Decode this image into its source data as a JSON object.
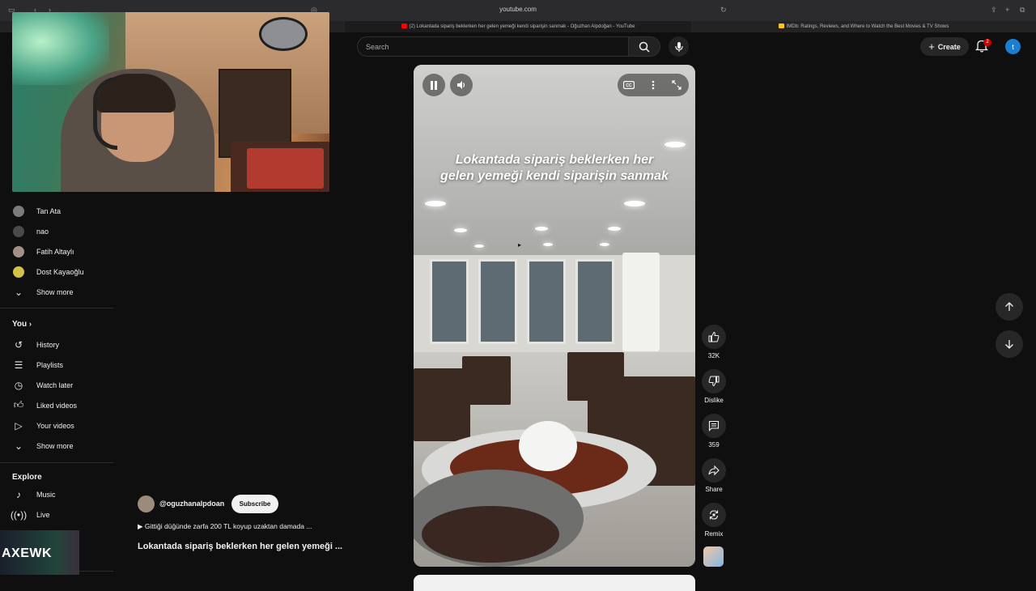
{
  "browser": {
    "url": "youtube.com",
    "tabs": [
      {
        "label": "(2) Lokantada sipariş beklerken her gelen yemeği kendi siparişin sanmak - Oğuzhan Alpdoğan - YouTube",
        "active": true
      },
      {
        "label": "IMDb: Ratings, Reviews, and Where to Watch the Best Movies & TV Shows",
        "active": false
      }
    ]
  },
  "search": {
    "placeholder": "Search"
  },
  "header": {
    "create_label": "Create",
    "notification_count": "2",
    "account_initial": "t"
  },
  "sidebar": {
    "subscriptions": [
      {
        "label": "Tan Ata",
        "color": "#7b7b7b"
      },
      {
        "label": "nao",
        "color": "#4a4a4a"
      },
      {
        "label": "Fatih Altaylı",
        "color": "#a48f86"
      },
      {
        "label": "Dost Kayaoğlu",
        "color": "#d3c24a"
      }
    ],
    "show_more_1": "Show more",
    "you_heading": "You",
    "you_items": [
      {
        "label": "History",
        "icon": "history-icon"
      },
      {
        "label": "Playlists",
        "icon": "playlists-icon"
      },
      {
        "label": "Watch later",
        "icon": "watch-later-icon"
      },
      {
        "label": "Liked videos",
        "icon": "like-icon"
      },
      {
        "label": "Your videos",
        "icon": "your-videos-icon"
      }
    ],
    "show_more_2": "Show more",
    "explore_heading": "Explore",
    "explore_items": [
      {
        "label": "Music",
        "icon": "music-icon"
      },
      {
        "label": "Live",
        "icon": "live-icon"
      }
    ]
  },
  "video": {
    "caption": "Lokantada sipariş beklerken her gelen yemeği kendi siparişin sanmak",
    "channel": "@oguzhanalpdoan",
    "subscribe_label": "Subscribe",
    "music": "Gittiği düğünde zarfa 200 TL koyup uzaktan damada ...",
    "title": "Lokantada sipariş beklerken her gelen yemeği ..."
  },
  "actions": {
    "likes": "32K",
    "dislike": "Dislike",
    "comments": "359",
    "share": "Share",
    "remix": "Remix"
  },
  "overlay": {
    "logo_text": "AXEWK"
  },
  "colors": {
    "background": "#0f0f0f",
    "surface": "#272727",
    "brand_red": "#cc0000",
    "avatar_blue": "#1a7fd0"
  }
}
